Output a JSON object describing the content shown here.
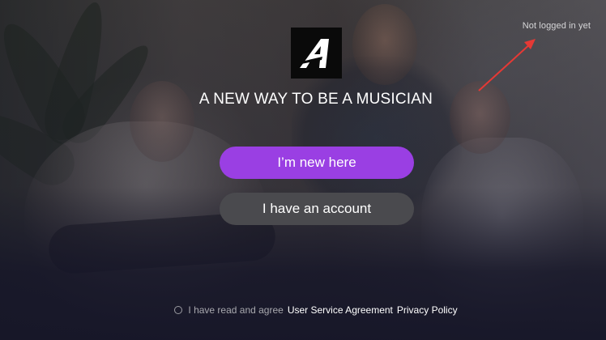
{
  "status": {
    "login_text": "Not logged in yet"
  },
  "brand": {
    "logo_letter": "A",
    "logo_icon": "brand-logo-icon"
  },
  "headline": "A NEW WAY TO BE A MUSICIAN",
  "buttons": {
    "new_label": "I’m new here",
    "account_label": "I have an account"
  },
  "agreement": {
    "prefix": "I have read and agree",
    "terms_link": "User Service Agreement",
    "privacy_link": "Privacy Policy",
    "checked": false
  },
  "colors": {
    "accent": "#9a3fe3",
    "secondary_button": "#4a4a4e",
    "arrow": "#e53935"
  }
}
